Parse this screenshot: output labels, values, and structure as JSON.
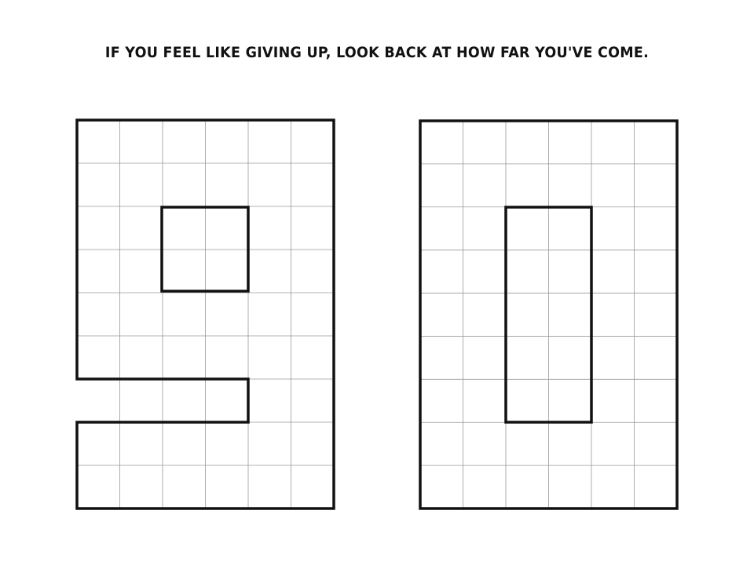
{
  "headline": "If you feel like giving up, look back at how far you've come.",
  "digits": [
    {
      "character": "9",
      "columns": 6,
      "rows": 9
    },
    {
      "character": "0",
      "columns": 6,
      "rows": 9
    }
  ],
  "colors": {
    "background": "#ffffff",
    "outline": "#111111",
    "grid": "#9a9a9a",
    "text": "#111111"
  }
}
